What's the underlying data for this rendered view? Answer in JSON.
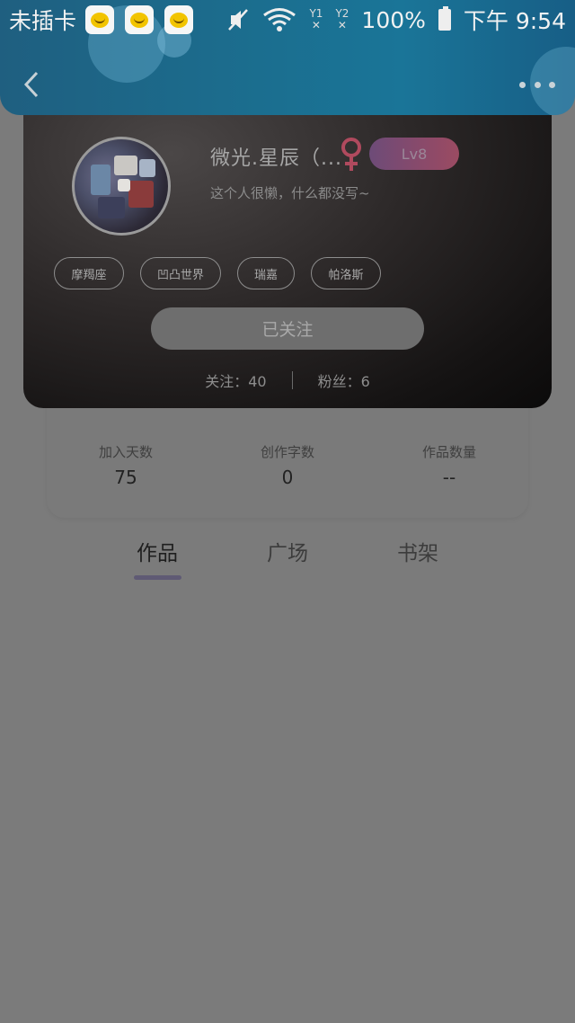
{
  "status_bar": {
    "carrier": "未插卡",
    "battery": "100%",
    "time": "下午 9:54",
    "sim1": "1",
    "sim2": "2",
    "notification_icons": [
      "messenger-app-icon",
      "messenger-app-icon",
      "messenger-app-icon"
    ]
  },
  "profile": {
    "username": "微光.星辰（...",
    "gender": "female",
    "level": "Lv8",
    "bio": "这个人很懒，什么都没写~",
    "tags": [
      "摩羯座",
      "凹凸世界",
      "瑞嘉",
      "帕洛斯"
    ],
    "follow_button": "已关注",
    "following_label": "关注：40",
    "followers_label": "粉丝：6"
  },
  "stats": [
    {
      "label": "加入天数",
      "value": "75"
    },
    {
      "label": "创作字数",
      "value": "0"
    },
    {
      "label": "作品数量",
      "value": "--"
    }
  ],
  "tabs": [
    {
      "label": "作品",
      "active": true
    },
    {
      "label": "广场",
      "active": false
    },
    {
      "label": "书架",
      "active": false
    }
  ],
  "colors": {
    "header_blue": "#1b6e8f",
    "level_badge": "#8a4a6a",
    "gender_female": "#b04a5e",
    "tab_indicator": "#5f5a74",
    "overlay_gray": "#7b7b7b"
  }
}
